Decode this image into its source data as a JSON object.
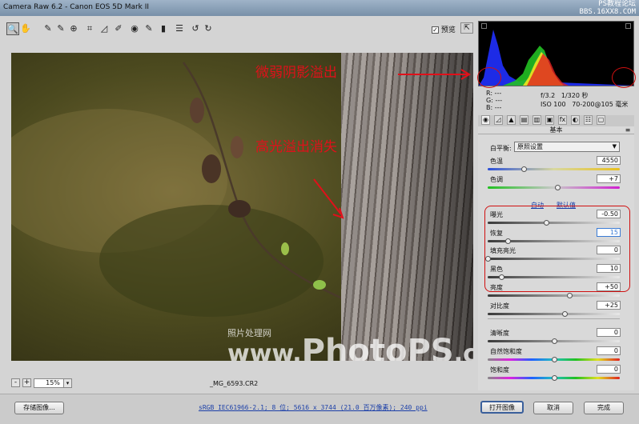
{
  "window": {
    "title": "Camera Raw 6.2 -  Canon EOS 5D Mark II",
    "watermark_line1": "PS教程论坛",
    "watermark_line2": "BBS.16XX8.COM"
  },
  "toolbar": {
    "tools": [
      "zoom-icon",
      "hand-icon",
      "white-balance-icon",
      "color-sampler-icon",
      "targeted-adjust-icon",
      "crop-icon",
      "straighten-icon",
      "spot-removal-icon",
      "red-eye-icon",
      "adjust-brush-icon",
      "graduated-filter-icon",
      "preferences-icon",
      "rotate-left-icon",
      "rotate-right-icon"
    ],
    "tool_glyphs": [
      "🔍",
      "✋",
      "✎",
      "✎",
      "⊕",
      "⌗",
      "◿",
      "✐",
      "◉",
      "✎",
      "▮",
      "☰",
      "↺",
      "↻"
    ],
    "preview_label": "预览",
    "preview_checked": "✓"
  },
  "annotations": {
    "shadow_clip": "微弱阴影溢出",
    "highlight_clip": "高光溢出消失"
  },
  "image_watermark": {
    "small": "照片处理网",
    "www": "www.",
    "brand": "PhotoPS",
    "suffix": ".com"
  },
  "zoom": {
    "minus": "-",
    "plus": "+",
    "value": "15%",
    "dropdown": "▾"
  },
  "filename": "_MG_6593.CR2",
  "bottom": {
    "save_label": "存储图像...",
    "workflow_text": "sRGB IEC61966-2.1; 8 位; 5616 x 3744 (21.0 百万像素); 240 ppi",
    "open_label": "打开图像",
    "cancel_label": "取消",
    "done_label": "完成"
  },
  "readout": {
    "r": "R:  ---",
    "g": "G:  ---",
    "b": "B:  ---",
    "aperture": "f/3.2",
    "shutter": "1/320 秒",
    "iso": "ISO 100",
    "lens": "70-200@105 毫米"
  },
  "panel": {
    "header": "基本",
    "white_balance_label": "白平衡:",
    "white_balance_value": "原照设置",
    "auto_label": "自动",
    "default_label": "默认值",
    "sliders": [
      {
        "label": "色温",
        "value": "4550",
        "level": 0.27
      },
      {
        "label": "色调",
        "value": "+7",
        "level": 0.53
      },
      {
        "label": "曝光",
        "value": "-0.50",
        "level": 0.44
      },
      {
        "label": "恢复",
        "value": "15",
        "level": 0.15
      },
      {
        "label": "填充亮光",
        "value": "0",
        "level": 0.0
      },
      {
        "label": "黑色",
        "value": "10",
        "level": 0.1
      },
      {
        "label": "亮度",
        "value": "+50",
        "level": 0.62
      },
      {
        "label": "对比度",
        "value": "+25",
        "level": 0.58
      },
      {
        "label": "清晰度",
        "value": "0",
        "level": 0.5
      },
      {
        "label": "自然饱和度",
        "value": "0",
        "level": 0.5
      },
      {
        "label": "饱和度",
        "value": "0",
        "level": 0.5
      }
    ]
  },
  "colors": {
    "annotation": "#e0101a",
    "accent_link": "#1b3fa8"
  }
}
